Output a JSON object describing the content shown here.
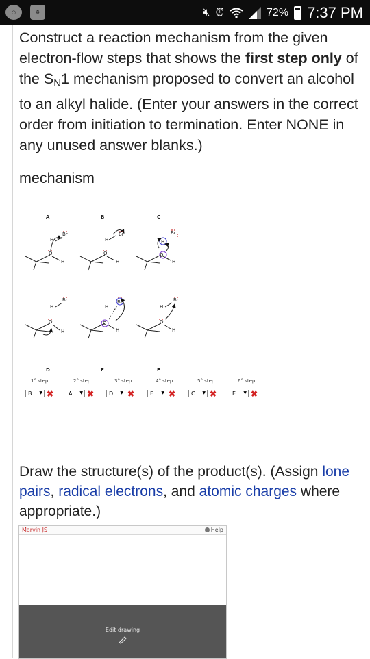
{
  "status_bar": {
    "battery": "72%",
    "battery_level": 0.72,
    "time": "7:37 PM",
    "icons": [
      "app-icon",
      "recycle-icon",
      "mute-icon",
      "alarm-icon",
      "wifi-icon",
      "signal-icon",
      "battery-icon"
    ]
  },
  "question": {
    "part1": "Construct a reaction mechanism from the given electron-flow steps that shows the ",
    "bold": "first step only",
    "part2": " of the S",
    "sub": "N",
    "part3": "1 mechanism proposed to convert an alcohol to an alkyl halide. (Enter your answers in the correct order from initiation to termination. Enter NONE in any unused answer blanks.)"
  },
  "mechanism_label": "mechanism",
  "figure": {
    "labels": [
      "A",
      "B",
      "C",
      "D",
      "E",
      "F"
    ],
    "atoms": {
      "H": "H",
      "O": "O",
      "Br": "Br"
    }
  },
  "steps": [
    {
      "label": "1° step",
      "value": "B"
    },
    {
      "label": "2° step",
      "value": "A"
    },
    {
      "label": "3° step",
      "value": "D"
    },
    {
      "label": "4° step",
      "value": "F"
    },
    {
      "label": "5° step",
      "value": "C"
    },
    {
      "label": "6° step",
      "value": "E"
    }
  ],
  "incorrect_mark": "✖",
  "dropdown_arrow": "▼",
  "draw": {
    "prefix": "Draw the structure(s) of the product(s). (Assign ",
    "link1": "lone pairs",
    "sep1": ", ",
    "link2": "radical electrons",
    "sep2": ", and ",
    "link3": "atomic charges",
    "suffix": " where appropriate.)"
  },
  "marvin": {
    "title": "Marvin JS",
    "help": "Help",
    "edit": "Edit drawing"
  },
  "colors": {
    "link": "#1a3ea8",
    "error": "#d32222",
    "editor_dark": "#555555",
    "circle": "#3a3ad0"
  }
}
